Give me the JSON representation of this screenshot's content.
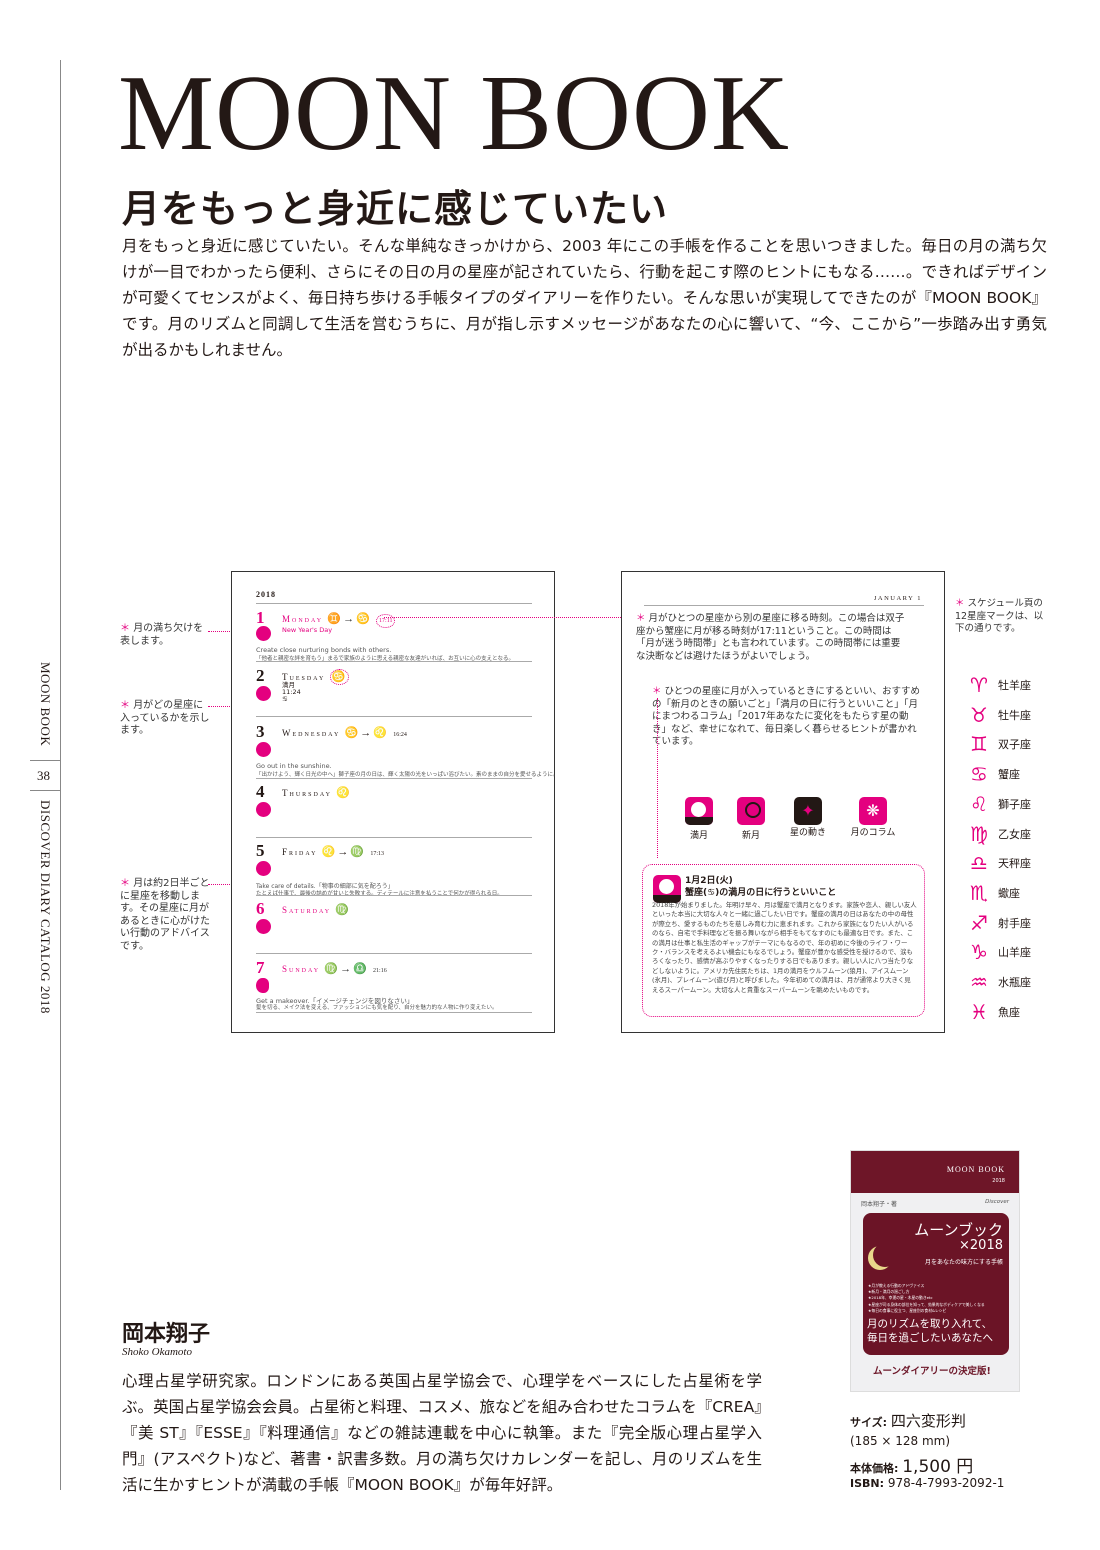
{
  "side": {
    "section": "MOON BOOK",
    "page": "38",
    "catalog": "DISCOVER DIARY CATALOG 2018"
  },
  "title": "MOON BOOK",
  "subtitle": "月をもっと身近に感じていたい",
  "intro": "月をもっと身近に感じていたい。そんな単純なきっかけから、2003 年にこの手帳を作ることを思いつきました。毎日の月の満ち欠けが一目でわかったら便利、さらにその日の月の星座が記されていたら、行動を起こす際のヒントにもなる……。できればデザインが可愛くてセンスがよく、毎日持ち歩ける手帳タイプのダイアリーを作りたい。そんな思いが実現してできたのが『MOON BOOK』です。月のリズムと同調して生活を営むうちに、月が指し示すメッセージがあなたの心に響いて、“今、ここから”一歩踏み出す勇気が出るかもしれません。",
  "accent": "#e4007f",
  "diary_left": {
    "year": "2018",
    "days": [
      {
        "num": "1",
        "name": "Monday",
        "sign": "♊→♋",
        "time": "17:11",
        "holiday": "New Year's Day",
        "en": "Create close nurturing bonds with others.",
        "jp": "「他者と親密な絆を育もう」まるで家族のように思える親密な友達がいれば、お互いに心の支えとなる。"
      },
      {
        "num": "2",
        "name": "Tuesday",
        "sign": "♋",
        "extra": [
          "満月",
          "11:24",
          "♋"
        ]
      },
      {
        "num": "3",
        "name": "Wednesday",
        "sign": "♋→♌",
        "time": "16:24",
        "en": "Go out in the sunshine.",
        "jp": "「出かけよう、輝く日光の中へ」獅子座の月の日は、輝く太陽の光をいっぱい浴びたい。素のままの自分を愛せるように。"
      },
      {
        "num": "4",
        "name": "Thursday",
        "sign": "♌"
      },
      {
        "num": "5",
        "name": "Friday",
        "sign": "♌→♍",
        "time": "17:13",
        "en": "Take care of details.「物事の細部に気を配ろう」",
        "jp": "たとえば仕事で、最後の詰めが甘いと失敗する。ディテールに注意を払うことで何かが得られる日。"
      },
      {
        "num": "6",
        "name": "Saturday",
        "sign": "♍"
      },
      {
        "num": "7",
        "name": "Sunday",
        "sign": "♍→♎",
        "time": "21:16",
        "en": "Get a makeover.「イメージチェンジを図りなさい」",
        "jp": "髪を切る、メイク法を変える、ファッションにも気を配り、自分を魅力的な人物に作り変えたい。"
      }
    ]
  },
  "notes_left": [
    "月の満ち欠けを表します。",
    "月がどの星座に入っているかを示します。",
    "月は約2日半ごとに星座を移動します。その星座に月があるときに心がけたい行動のアドバイスです。"
  ],
  "diary_right": {
    "header": "JANUARY 1",
    "note1": "月がひとつの星座から別の星座に移る時刻。この場合は双子座から蟹座に月が移る時刻が17:11ということ。この時間は「月が迷う時間帯」とも言われています。この時間帯には重要な決断などは避けたほうがよいでしょう。",
    "note2": "ひとつの星座に月が入っているときにするといい、おすすめの「新月のときの願いごと」「満月の日に行うといいこと」「月にまつわるコラム」「2017年あなたに変化をもたらす星の動き」など、幸せになれて、毎日楽しく暮らせるヒントが書かれています。",
    "icons": [
      {
        "label": "満月",
        "icon": "full-moon-icon"
      },
      {
        "label": "新月",
        "icon": "new-moon-icon"
      },
      {
        "label": "星の動き",
        "icon": "stars-icon"
      },
      {
        "label": "月のコラム",
        "icon": "column-icon"
      }
    ],
    "box_date": "1月2日(火)",
    "box_title": "蟹座(♋)の満月の日に行うといいこと",
    "box_text": "2018年が始まりました。年明け早々、月は蟹座で満月となります。家族や恋人、親しい友人といった本当に大切な人々と一緒に過ごしたい日です。蟹座の満月の日はあなたの中の母性が際立ち、愛するものたちを慈しみ育む力に恵まれます。これから家族になりたい人がいるのなら、自宅で手料理などを振る舞いながら相手をもてなすのにも最適な日です。また、この満月は仕事と私生活のギャップがテーマにもなるので、年の初めに今後のライフ・ワーク・バランスを考えるよい機会にもなるでしょう。蟹座が豊かな感受性を授けるので、涙もろくなったり、感情が高ぶりやすくなったりする日でもあります。親しい人に八つ当たりなどしないように。アメリカ先住民たちは、1月の満月をウルフムーン(狼月)、アイスムーン(氷月)、プレイムーン(遊び月)と呼びました。今年初めての満月は、月が通常より大きく見えるスーパームーン。大切な人と貴重なスーパームーンを眺めたいものです。"
  },
  "zodiac_note": "スケジュール頁の12星座マークは、以下の通りです。",
  "zodiac": [
    {
      "sym": "♈",
      "name": "牡羊座"
    },
    {
      "sym": "♉",
      "name": "牡牛座"
    },
    {
      "sym": "♊",
      "name": "双子座"
    },
    {
      "sym": "♋",
      "name": "蟹座"
    },
    {
      "sym": "♌",
      "name": "獅子座"
    },
    {
      "sym": "♍",
      "name": "乙女座"
    },
    {
      "sym": "♎",
      "name": "天秤座"
    },
    {
      "sym": "♏",
      "name": "蠍座"
    },
    {
      "sym": "♐",
      "name": "射手座"
    },
    {
      "sym": "♑",
      "name": "山羊座"
    },
    {
      "sym": "♒",
      "name": "水瓶座"
    },
    {
      "sym": "♓",
      "name": "魚座"
    }
  ],
  "cover": {
    "brand": "MOON BOOK",
    "year": "2018",
    "author": "岡本翔子・著",
    "publisher": "Discover",
    "title": "ムーンブック",
    "title_year": "×2018",
    "tagline": "月をあなたの味方にする手帳",
    "bullets": [
      "★月が教える行動のアドヴァイス",
      "★新月・満月の過ごし方",
      "★2018年、幸運の星・木星の動きetc",
      "★星座が司る身体の部位を知って、効果的なボディケアで美しくなる",
      "★毎日の食事に役立つ、星座別の食材&レシピ"
    ],
    "headline1": "月のリズムを取り入れて、",
    "headline2": "毎日を過ごしたいあなたへ",
    "banner": "ムーンダイアリーの決定版!"
  },
  "author": {
    "name": "岡本翔子",
    "roman": "Shoko Okamoto",
    "bio": "心理占星学研究家。ロンドンにある英国占星学協会で、心理学をベースにした占星術を学ぶ。英国占星学協会会員。占星術と料理、コスメ、旅などを組み合わせたコラムを『CREA』『美 ST』『ESSE』『料理通信』などの雑誌連載を中心に執筆。また『完全版心理占星学入門』(アスペクト)など、著書・訳書多数。月の満ち欠けカレンダーを記し、月のリズムを生活に生かすヒントが満載の手帳『MOON BOOK』が毎年好評。"
  },
  "specs": {
    "size_label": "サイズ:",
    "size": "四六変形判",
    "dims": "(185 × 128 mm)",
    "price_label": "本体価格:",
    "price": "1,500 円",
    "isbn_label": "ISBN:",
    "isbn": "978-4-7993-2092-1"
  }
}
